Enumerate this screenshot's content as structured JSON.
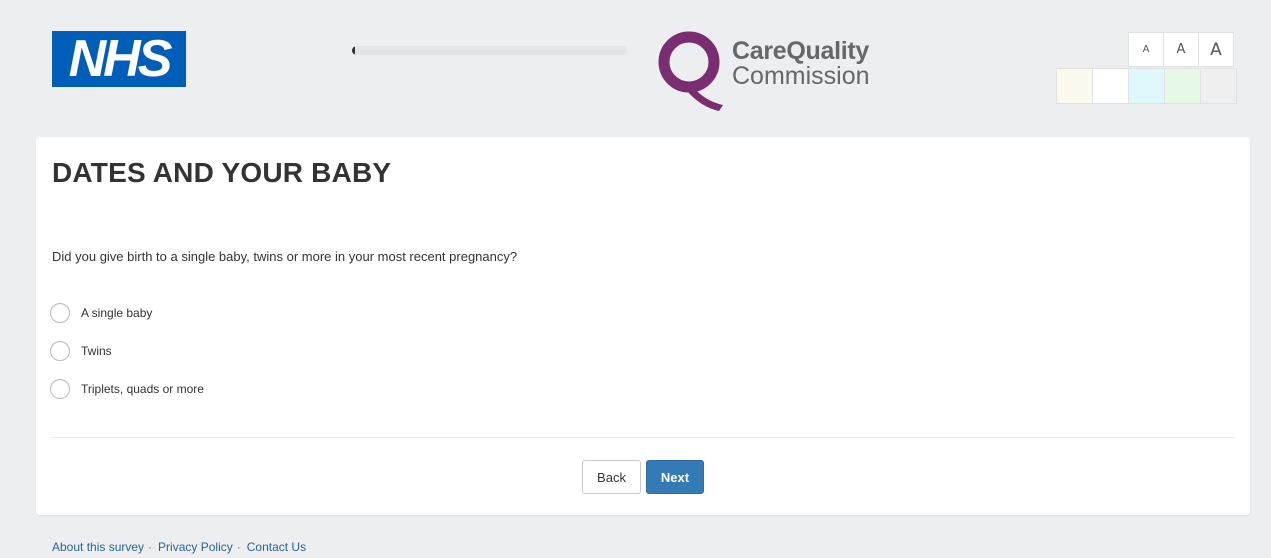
{
  "header": {
    "nhs_logo_text": "NHS",
    "progress_fraction": 0.01,
    "cqc_logo": {
      "line1": "CareQuality",
      "line2": "Commission",
      "mark_color": "#7b2d72",
      "text_color": "#66676b"
    },
    "text_size_buttons": [
      {
        "label": "A"
      },
      {
        "label": "A"
      },
      {
        "label": "A"
      }
    ],
    "theme_colors": [
      "#fbf8ee",
      "#ffffff",
      "#dff7fb",
      "#e6f8e6",
      "#eeefee"
    ]
  },
  "main": {
    "title": "DATES AND YOUR BABY",
    "question": "Did you give birth to a single baby, twins or more in your most recent pregnancy?",
    "options": [
      {
        "label": "A single baby"
      },
      {
        "label": "Twins"
      },
      {
        "label": "Triplets, quads or more"
      }
    ],
    "back_label": "Back",
    "next_label": "Next"
  },
  "footer": {
    "links": [
      {
        "label": "About this survey"
      },
      {
        "label": "Privacy Policy"
      },
      {
        "label": "Contact Us"
      }
    ],
    "separator": "·"
  },
  "colors": {
    "nhs_blue": "#005eb8",
    "primary_button": "#337ab7",
    "link": "#2a6496",
    "background": "#eceeef"
  }
}
